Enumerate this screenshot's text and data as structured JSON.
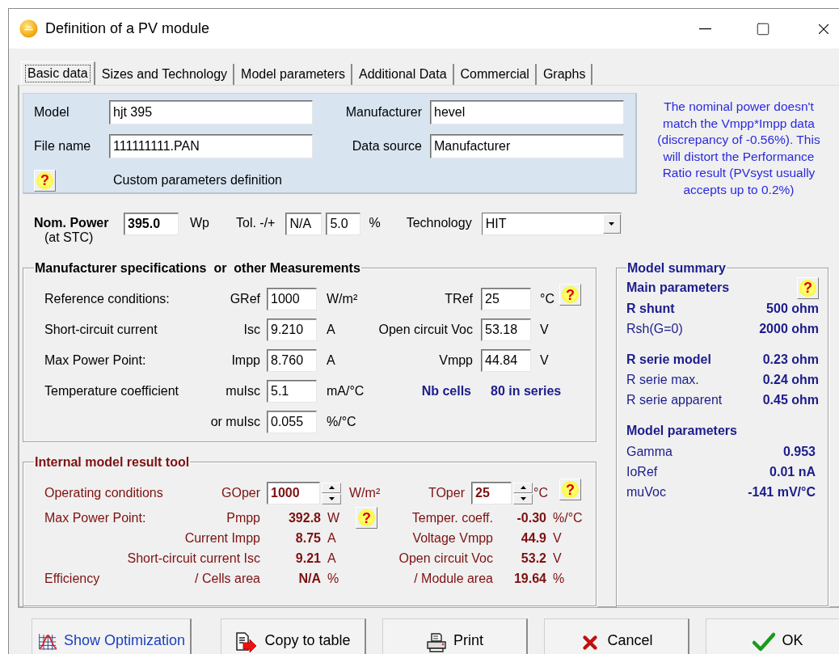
{
  "window": {
    "title": "Definition of a PV module"
  },
  "tabs": [
    {
      "label": "Basic data",
      "selected": true
    },
    {
      "label": "Sizes and Technology",
      "selected": false
    },
    {
      "label": "Model parameters",
      "selected": false
    },
    {
      "label": "Additional Data",
      "selected": false
    },
    {
      "label": "Commercial",
      "selected": false
    },
    {
      "label": "Graphs",
      "selected": false
    }
  ],
  "identity": {
    "rows": [
      {
        "label": "Model",
        "value": "hjt 395",
        "label2": "Manufacturer",
        "value2": "hevel"
      },
      {
        "label": "File name",
        "value": "111111111.PAN",
        "label2": "Data source",
        "value2": "Manufacturer"
      }
    ],
    "help": "?",
    "caption": "Custom parameters definition"
  },
  "warning": "The nominal power doesn't match the Vmpp*Impp data (discrepancy of -0.56%). This will distort the Performance Ratio result (PVsyst usually accepts up to 0.2%)",
  "nominal": {
    "label": "Nom. Power",
    "sublabel": "(at STC)",
    "value": "395.0",
    "unit": "Wp",
    "tol_label": "Tol. -/+",
    "tol_minus": "N/A",
    "tol_plus": "5.0",
    "tol_unit": "%",
    "tech_label": "Technology",
    "tech_value": "HIT"
  },
  "specs": {
    "title": "Manufacturer specifications  or  other Measurements",
    "rows": [
      {
        "label": "Reference conditions:",
        "param": "GRef",
        "value": "1000",
        "unit": "W/m²",
        "param2": "TRef",
        "value2": "25",
        "unit2": "°C",
        "help": "?"
      },
      {
        "label": "Short-circuit current",
        "param": "Isc",
        "value": "9.210",
        "unit": "A",
        "param2": "Open circuit Voc",
        "value2": "53.18",
        "unit2": "V"
      },
      {
        "label": "Max Power Point:",
        "param": "Impp",
        "value": "8.760",
        "unit": "A",
        "param2": "Vmpp",
        "value2": "44.84",
        "unit2": "V"
      },
      {
        "label": "Temperature coefficient",
        "param": "muIsc",
        "value": "5.1",
        "unit": "mA/°C",
        "note_label": "Nb cells",
        "note_value": "80 in series"
      },
      {
        "param": "or muIsc",
        "value": "0.055",
        "unit": "%/°C"
      }
    ]
  },
  "result_tool": {
    "title": "Internal model result tool",
    "operating": {
      "label": "Operating conditions",
      "param": "GOper",
      "value": "1000",
      "unit": "W/m²",
      "param2": "TOper",
      "value2": "25",
      "unit2": "°C",
      "help": "?"
    },
    "rows": [
      {
        "label": "Max Power Point:",
        "param": "Pmpp",
        "value": "392.8",
        "unit": "W",
        "help": "?",
        "param2": "Temper. coeff.",
        "value2": "-0.30",
        "unit2": "%/°C"
      },
      {
        "param": "Current Impp",
        "value": "8.75",
        "unit": "A",
        "param2": "Voltage Vmpp",
        "value2": "44.9",
        "unit2": "V"
      },
      {
        "param": "Short-circuit current Isc",
        "value": "9.21",
        "unit": "A",
        "param2": "Open circuit Voc",
        "value2": "53.2",
        "unit2": "V"
      },
      {
        "label": "Efficiency",
        "param": "/ Cells area",
        "value": "N/A",
        "unit": "%",
        "param2": "/ Module area",
        "value2": "19.64",
        "unit2": "%"
      }
    ]
  },
  "model_summary": {
    "title": "Model summary",
    "heading": "Main parameters",
    "help": "?",
    "groups": [
      {
        "rows": [
          {
            "label": "R shunt",
            "value": "500 ohm",
            "emphasis": true
          },
          {
            "label": "Rsh(G=0)",
            "value": "2000 ohm",
            "emphasis": false
          }
        ]
      },
      {
        "rows": [
          {
            "label": "R serie model",
            "value": "0.23 ohm",
            "emphasis": true
          },
          {
            "label": "R serie max.",
            "value": "0.24 ohm",
            "emphasis": false
          },
          {
            "label": "R serie apparent",
            "value": "0.45 ohm",
            "emphasis": false
          }
        ]
      }
    ],
    "params_heading": "Model parameters",
    "params": [
      {
        "label": "Gamma",
        "value": "0.953"
      },
      {
        "label": "IoRef",
        "value": "0.01 nA"
      },
      {
        "label": "muVoc",
        "value": "-141 mV/°C"
      }
    ]
  },
  "buttons": [
    {
      "kind": "optimize",
      "label": "Show Optimization"
    },
    {
      "kind": "copy",
      "label": "Copy to table"
    },
    {
      "kind": "print",
      "label": "Print"
    },
    {
      "kind": "cancel",
      "label": "Cancel"
    },
    {
      "kind": "ok",
      "label": "OK"
    }
  ]
}
